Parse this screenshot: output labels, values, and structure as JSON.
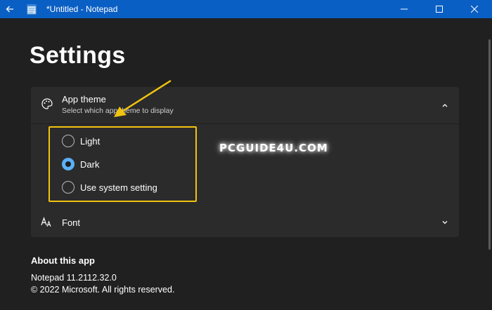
{
  "window": {
    "title": "*Untitled - Notepad",
    "accent_color": "#0a5fc4"
  },
  "page": {
    "title": "Settings"
  },
  "theme_card": {
    "title": "App theme",
    "subtitle": "Select which app theme to display",
    "icon": "palette-icon",
    "expanded": true,
    "options": [
      {
        "label": "Light",
        "checked": false
      },
      {
        "label": "Dark",
        "checked": true
      },
      {
        "label": "Use system setting",
        "checked": false
      }
    ]
  },
  "font_card": {
    "title": "Font",
    "icon": "font-icon",
    "expanded": false
  },
  "about": {
    "heading": "About this app",
    "version": "Notepad 11.2112.32.0",
    "copyright": "© 2022 Microsoft. All rights reserved."
  },
  "watermark": "PCGUIDE4U.COM",
  "colors": {
    "highlight_box": "#f1c40f",
    "radio_selected": "#5ab0f7",
    "background": "#202020",
    "card": "#2b2b2b"
  }
}
